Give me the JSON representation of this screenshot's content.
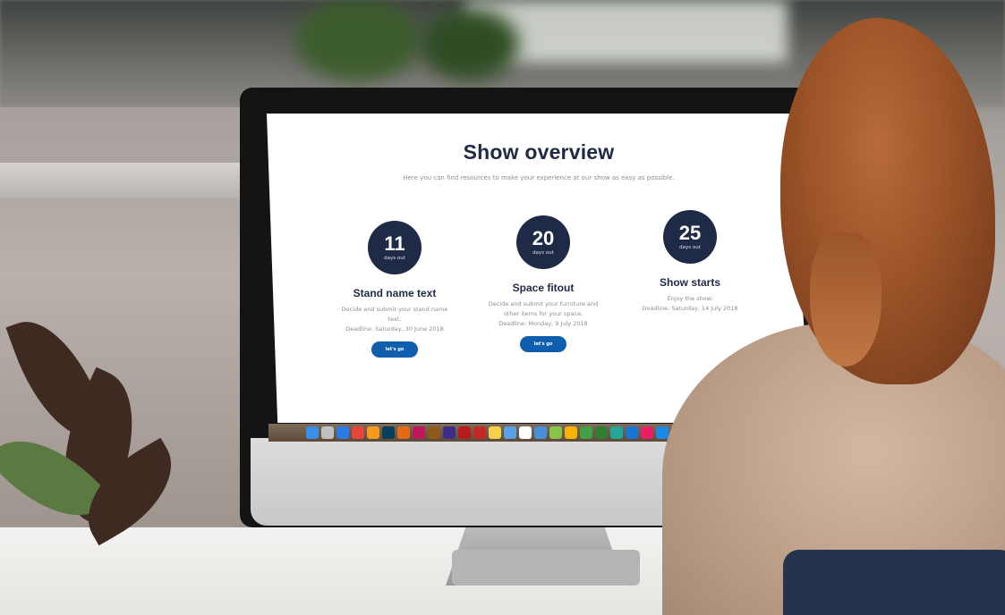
{
  "screen": {
    "title": "Show overview",
    "subtitle": "Here you can find resources to make your experience at our show as easy as possible.",
    "steps": [
      {
        "number": "11",
        "caption": "days out",
        "title": "Stand name text",
        "description": "Decide and submit your stand name text.",
        "deadline": "Deadline: Saturday, 30 June 2018",
        "button": "let's go"
      },
      {
        "number": "20",
        "caption": "days out",
        "title": "Space fitout",
        "description": "Decide and submit your furniture and other items for your space.",
        "deadline": "Deadline: Monday, 9 July 2018",
        "button": "let's go"
      },
      {
        "number": "25",
        "caption": "days out",
        "title": "Show starts",
        "description": "Enjoy the show.",
        "deadline": "Deadline: Saturday, 14 July 2018"
      }
    ]
  },
  "colors": {
    "navy": "#1f2a47",
    "button_blue": "#0f5fae",
    "text_grey": "#8a8f99"
  },
  "dock": {
    "icons": [
      "finder-icon",
      "launchpad-icon",
      "safari-icon",
      "chrome-icon",
      "firefox-icon",
      "photoshop-icon",
      "illustrator-icon",
      "indesign-icon",
      "bridge-icon",
      "after-effects-icon",
      "acrobat-icon",
      "acrobat-icon",
      "notes-icon",
      "preview-icon",
      "calendar-icon",
      "folder-icon",
      "maps-icon",
      "photos-icon",
      "messages-icon",
      "facetime-icon",
      "numbers-icon",
      "keynote-icon",
      "itunes-icon",
      "app-store-icon",
      "settings-icon",
      "trash-icon"
    ]
  }
}
